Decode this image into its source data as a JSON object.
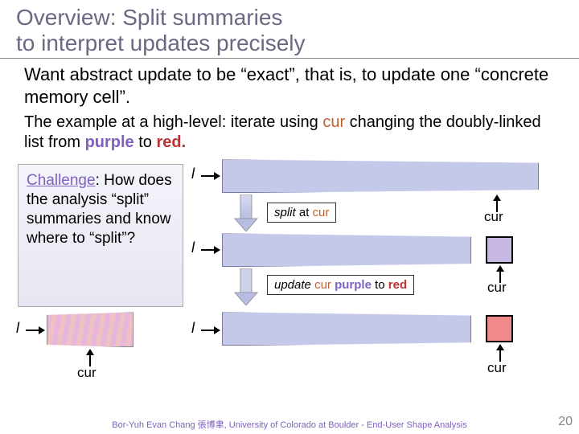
{
  "title_l1": "Overview: Split summaries",
  "title_l2": "to interpret updates precisely",
  "p1_a": "Want abstract update to be “exact”, that is, to update one “concrete memory cell”.",
  "p2_a": "The example at a high-level: iterate using ",
  "p2_cur": "cur",
  "p2_b": " changing the doubly-linked list from ",
  "p2_purple": "purple",
  "p2_c": " to ",
  "p2_red": "red.",
  "challenge_title": "Challenge",
  "challenge_body": ": How does the analysis “split” summaries and know where to “split”?",
  "l": "l",
  "cur": "cur",
  "split_a": "split",
  "split_b": " at ",
  "update_a": "update",
  "update_b": " ",
  "update_c": " to ",
  "footer": "Bor-Yuh Evan Chang 張博聿, University of Colorado at Boulder - End-User Shape Analysis",
  "page": "20",
  "colors": {
    "purple": "#8060c0",
    "red": "#c03030",
    "blue": "#c4c9ea"
  }
}
